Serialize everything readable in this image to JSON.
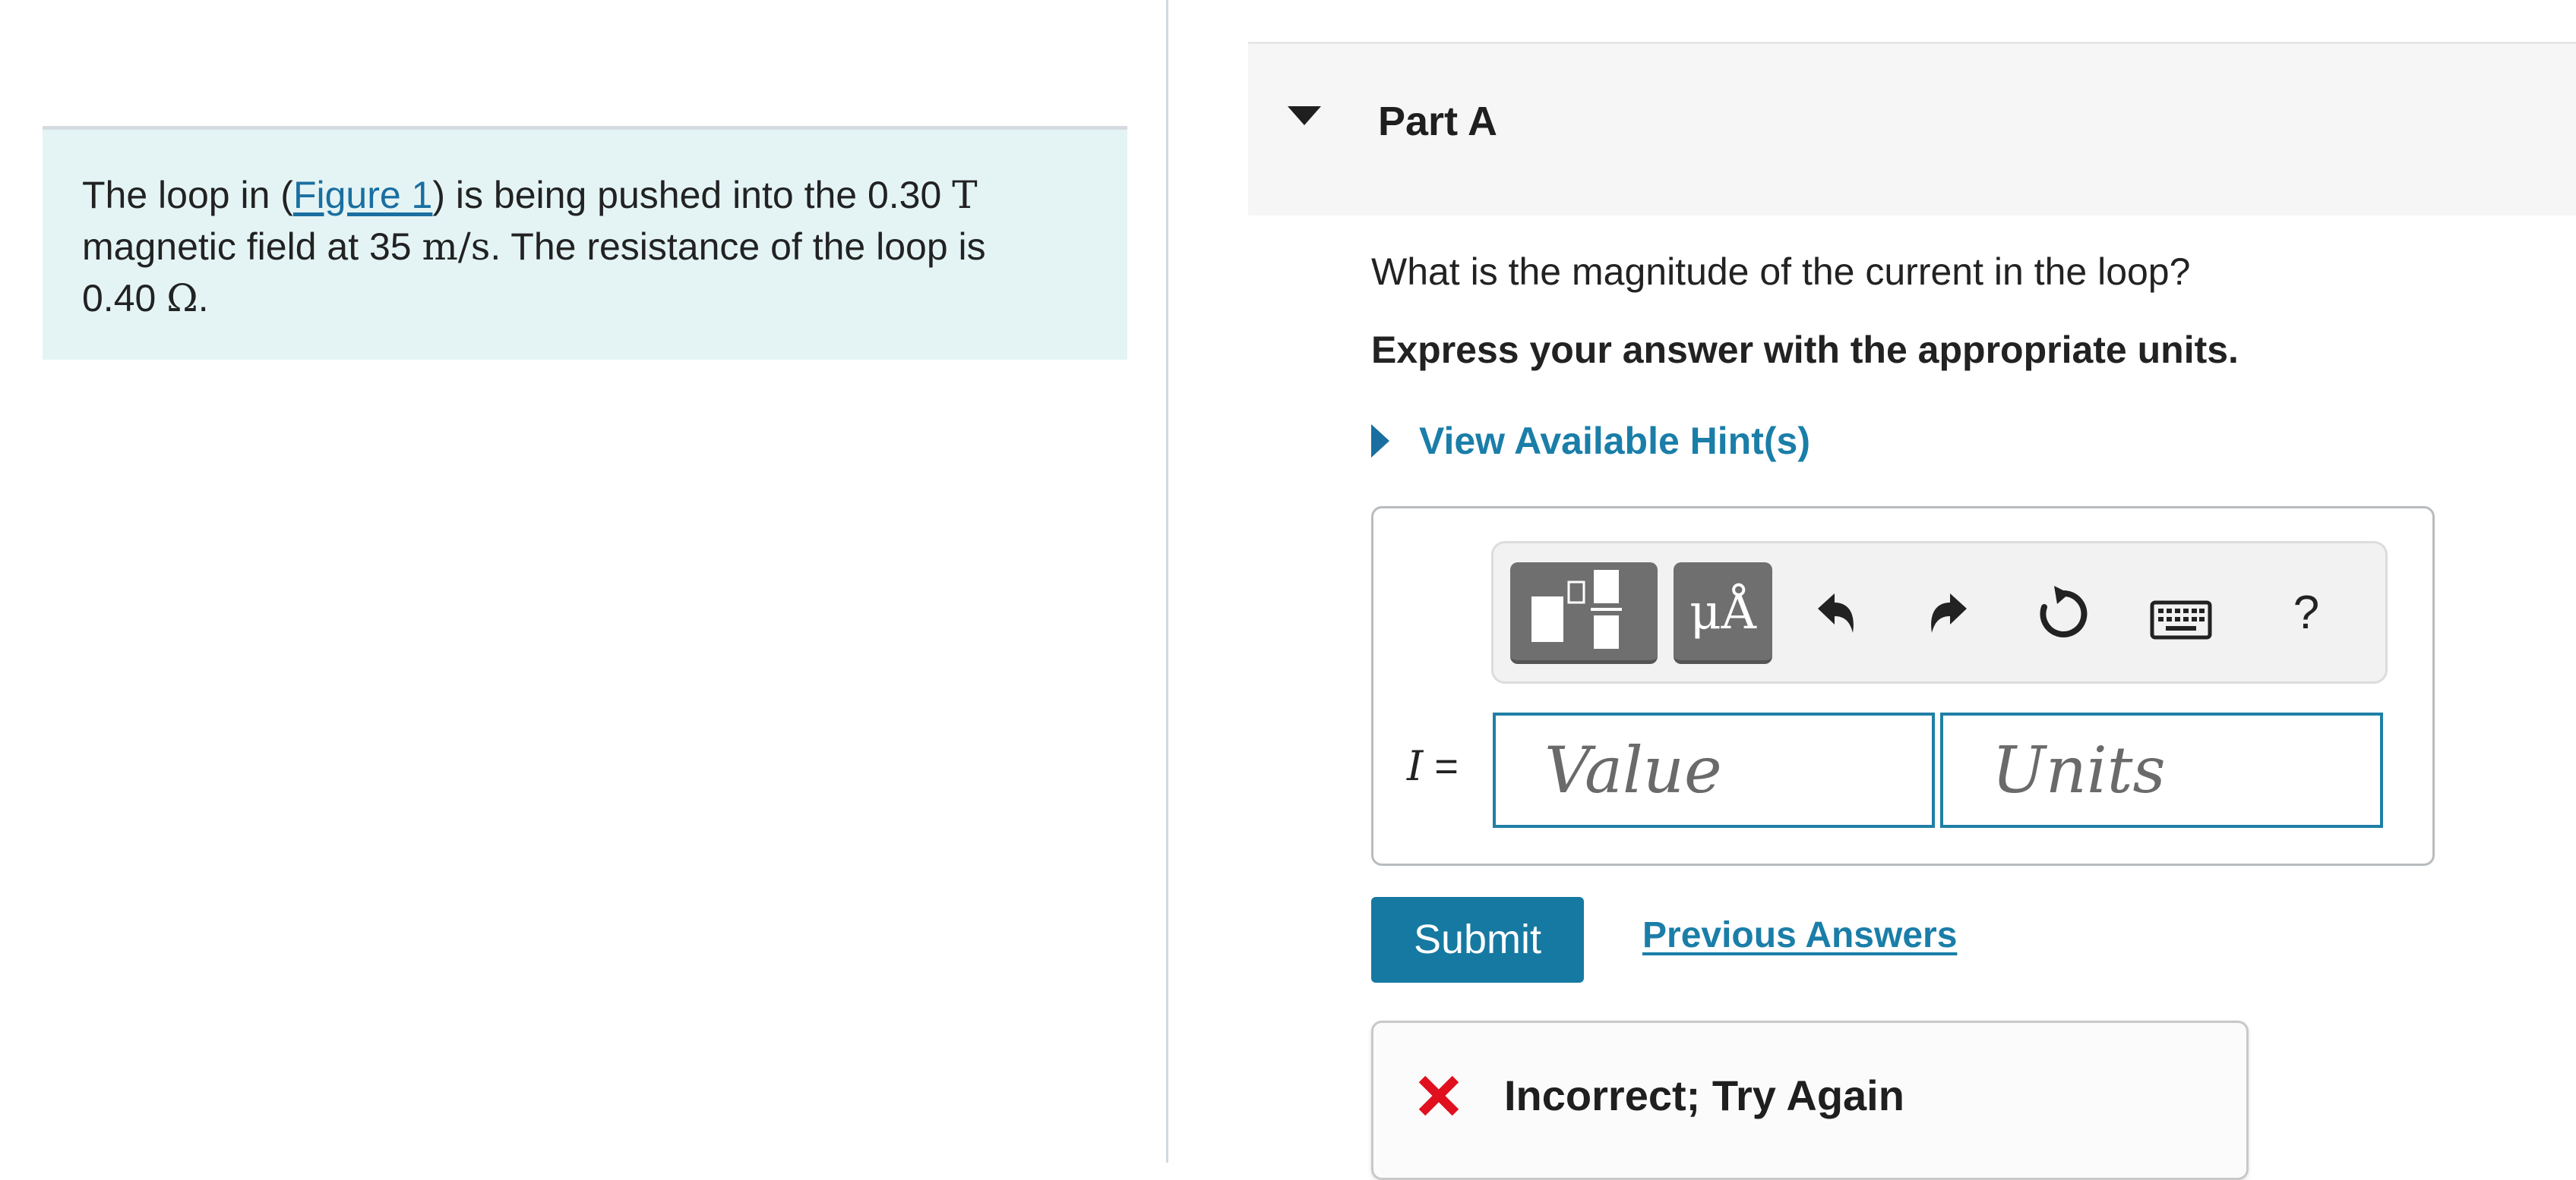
{
  "problem": {
    "text_before_link": "The loop in (",
    "figure_link": "Figure 1",
    "text_after_link": ") is being pushed into the 0.30 ",
    "field_unit": "T",
    "line2_start": "magnetic field at 35 ",
    "speed_unit": "m/s",
    "line2_end": ". The resistance of the loop is",
    "resistance_value": "0.40 ",
    "resistance_unit": "Ω",
    "end_period": "."
  },
  "part": {
    "title": "Part A",
    "question": "What is the magnitude of the current in the loop?",
    "instruction": "Express your answer with the appropriate units.",
    "hint_label": "View Available Hint(s)"
  },
  "toolbar": {
    "units_symbol": "μÅ",
    "help_symbol": "?"
  },
  "answer": {
    "variable": "I",
    "equals": " =",
    "value_placeholder": "Value",
    "units_placeholder": "Units",
    "value": "",
    "units": ""
  },
  "actions": {
    "submit_label": "Submit",
    "previous_answers_label": "Previous Answers"
  },
  "feedback": {
    "message": "Incorrect; Try Again",
    "status_color": "#e0101e"
  },
  "colors": {
    "accent": "#1679a1",
    "link": "#1a7ea8",
    "problem_background": "#e4f4f5",
    "part_header_background": "#f6f6f6"
  }
}
